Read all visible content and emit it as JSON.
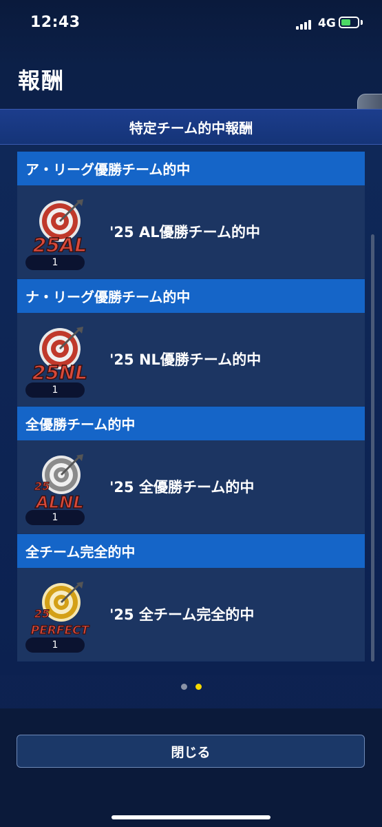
{
  "status_bar": {
    "time": "12:43",
    "network": "4G"
  },
  "page": {
    "title": "報酬"
  },
  "section": {
    "title": "特定チーム的中報酬"
  },
  "groups": [
    {
      "header": "ア・リーグ優勝チーム的中",
      "reward": {
        "name": "'25 AL優勝チーム的中",
        "quantity": "1",
        "badge_text": "25AL",
        "badge_color": "#c0392b"
      }
    },
    {
      "header": "ナ・リーグ優勝チーム的中",
      "reward": {
        "name": "'25 NL優勝チーム的中",
        "quantity": "1",
        "badge_text": "25NL",
        "badge_color": "#c0392b"
      }
    },
    {
      "header": "全優勝チーム的中",
      "reward": {
        "name": "'25 全優勝チーム的中",
        "quantity": "1",
        "badge_text_top": "25",
        "badge_text": "ALNL",
        "badge_color": "#8a8a8a"
      }
    },
    {
      "header": "全チーム完全的中",
      "reward": {
        "name": "'25 全チーム完全的中",
        "quantity": "1",
        "badge_text_top": "25",
        "badge_text": "PERFECT",
        "badge_color": "#d4a017"
      }
    }
  ],
  "pagination": {
    "total": 2,
    "active": 2,
    "colors": {
      "inactive": "#8a93a6",
      "active": "#f5d800"
    }
  },
  "footer": {
    "close_label": "閉じる"
  },
  "icons": {
    "side_tab": "chevron-left-icon"
  }
}
